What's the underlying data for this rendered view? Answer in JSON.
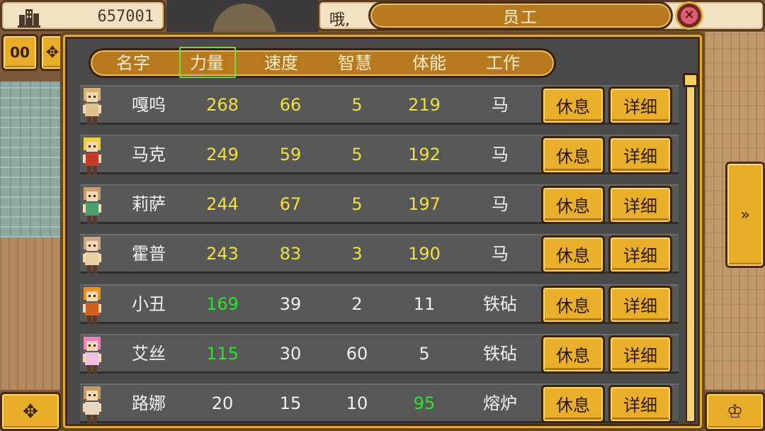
{
  "top_bar": {
    "money": "657001",
    "building_icon": "building-icon",
    "message": "哦,",
    "window_title": "员工",
    "close_icon": "close-icon"
  },
  "side_buttons": {
    "pause_label": "00",
    "left_icon": "settings-icon",
    "dpad_icon": "dpad-icon",
    "next_icon": "fast-forward-icon",
    "crown_icon": "crown-icon"
  },
  "header": {
    "columns": [
      "名字",
      "力量",
      "速度",
      "智慧",
      "体能",
      "工作"
    ],
    "selected_column": "力量"
  },
  "colors": {
    "stat_yellow": "#f0e040",
    "stat_green": "#2ee22e",
    "stat_white": "#f0f0f0",
    "gold": "#e9ae2a"
  },
  "employees": [
    {
      "name": "嘎呜",
      "strength": "268",
      "speed": "66",
      "wisdom": "5",
      "stamina": "219",
      "job": "马",
      "colors": [
        "y",
        "y",
        "y",
        "y"
      ],
      "rest": "休息",
      "detail": "详细"
    },
    {
      "name": "马克",
      "strength": "249",
      "speed": "59",
      "wisdom": "5",
      "stamina": "192",
      "job": "马",
      "colors": [
        "y",
        "y",
        "y",
        "y"
      ],
      "rest": "休息",
      "detail": "详细"
    },
    {
      "name": "莉萨",
      "strength": "244",
      "speed": "67",
      "wisdom": "5",
      "stamina": "197",
      "job": "马",
      "colors": [
        "y",
        "y",
        "y",
        "y"
      ],
      "rest": "休息",
      "detail": "详细"
    },
    {
      "name": "霍普",
      "strength": "243",
      "speed": "83",
      "wisdom": "3",
      "stamina": "190",
      "job": "马",
      "colors": [
        "y",
        "y",
        "y",
        "y"
      ],
      "rest": "休息",
      "detail": "详细"
    },
    {
      "name": "小丑",
      "strength": "169",
      "speed": "39",
      "wisdom": "2",
      "stamina": "11",
      "job": "铁砧",
      "colors": [
        "g",
        "w",
        "w",
        "w"
      ],
      "rest": "休息",
      "detail": "详细"
    },
    {
      "name": "艾丝",
      "strength": "115",
      "speed": "30",
      "wisdom": "60",
      "stamina": "5",
      "job": "铁砧",
      "colors": [
        "g",
        "w",
        "w",
        "w"
      ],
      "rest": "休息",
      "detail": "详细"
    },
    {
      "name": "路娜",
      "strength": "20",
      "speed": "15",
      "wisdom": "10",
      "stamina": "95",
      "job": "熔炉",
      "colors": [
        "w",
        "w",
        "w",
        "g"
      ],
      "rest": "休息",
      "detail": "详细"
    }
  ]
}
